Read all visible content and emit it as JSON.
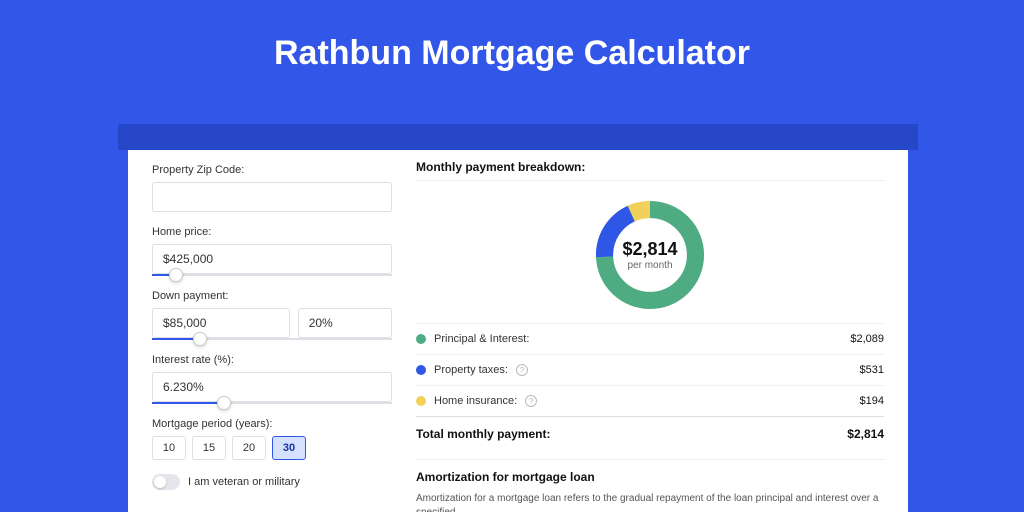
{
  "header": {
    "title": "Rathbun Mortgage Calculator"
  },
  "form": {
    "zip_label": "Property Zip Code:",
    "zip_value": "",
    "home_price_label": "Home price:",
    "home_price_value": "$425,000",
    "home_price_slider_pct": 10,
    "down_payment_label": "Down payment:",
    "down_payment_value": "$85,000",
    "down_payment_pct": "20%",
    "down_payment_slider_pct": 20,
    "interest_label": "Interest rate (%):",
    "interest_value": "6.230%",
    "interest_slider_pct": 30,
    "period_label": "Mortgage period (years):",
    "periods": [
      "10",
      "15",
      "20",
      "30"
    ],
    "period_active_index": 3,
    "veteran_label": "I am veteran or military"
  },
  "breakdown": {
    "title": "Monthly payment breakdown:",
    "center_amount": "$2,814",
    "center_sub": "per month",
    "items": [
      {
        "color": "#4eab82",
        "label": "Principal & Interest:",
        "value": "$2,089",
        "help": false
      },
      {
        "color": "#2f57e5",
        "label": "Property taxes:",
        "value": "$531",
        "help": true
      },
      {
        "color": "#f2d15a",
        "label": "Home insurance:",
        "value": "$194",
        "help": true
      }
    ],
    "total_label": "Total monthly payment:",
    "total_value": "$2,814"
  },
  "chart_data": {
    "type": "pie",
    "title": "Monthly payment breakdown",
    "series": [
      {
        "name": "Principal & Interest",
        "value": 2089,
        "pct": 74.2,
        "color": "#4eab82"
      },
      {
        "name": "Property taxes",
        "value": 531,
        "pct": 18.9,
        "color": "#2f57e5"
      },
      {
        "name": "Home insurance",
        "value": 194,
        "pct": 6.9,
        "color": "#f2d15a"
      }
    ],
    "total": 2814,
    "center_label": "$2,814 per month"
  },
  "amort": {
    "title": "Amortization for mortgage loan",
    "text": "Amortization for a mortgage loan refers to the gradual repayment of the loan principal and interest over a specified"
  }
}
